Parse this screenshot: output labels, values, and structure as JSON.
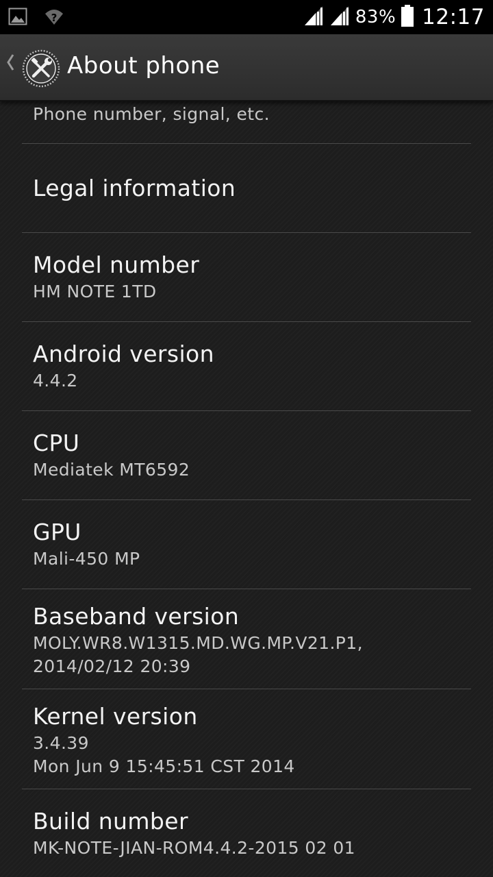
{
  "status_bar": {
    "battery_percent": "83%",
    "time": "12:17",
    "icons": [
      "gallery-icon",
      "wifi-question-icon",
      "signal-icon",
      "signal-icon",
      "battery-icon"
    ]
  },
  "action_bar": {
    "title": "About phone",
    "icon": "settings-tools-icon"
  },
  "items": {
    "status_summary": "Phone number, signal, etc.",
    "legal": {
      "title": "Legal information"
    },
    "model": {
      "title": "Model number",
      "summary": "HM NOTE 1TD"
    },
    "android": {
      "title": "Android version",
      "summary": "4.4.2"
    },
    "cpu": {
      "title": "CPU",
      "summary": "Mediatek MT6592"
    },
    "gpu": {
      "title": "GPU",
      "summary": "Mali-450 MP"
    },
    "baseband": {
      "title": "Baseband version",
      "summary": "MOLY.WR8.W1315.MD.WG.MP.V21.P1,\n2014/02/12 20:39"
    },
    "kernel": {
      "title": "Kernel version",
      "summary": "3.4.39\nMon Jun 9 15:45:51 CST 2014"
    },
    "build": {
      "title": "Build number",
      "summary": "MK-NOTE-JIAN-ROM4.4.2-2015 02 01"
    }
  },
  "colors": {
    "background": "#1d1d1d",
    "status_bar": "#000000",
    "action_bar": "#333333",
    "divider": "#4a4a4a",
    "title_text": "#f3f3f3",
    "summary_text": "#c9c9c9"
  }
}
